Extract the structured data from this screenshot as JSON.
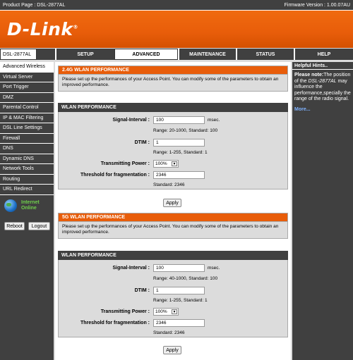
{
  "topbar": {
    "product": "Product Page : DSL-2877AL",
    "firmware": "Firmware Version : 1.00.07AU"
  },
  "brand": {
    "logo": "D-Link",
    "dot": "®"
  },
  "nav": {
    "model": "DSL-2877AL",
    "tabs": [
      "SETUP",
      "ADVANCED",
      "MAINTENANCE",
      "STATUS",
      "HELP"
    ],
    "active_tab": "ADVANCED"
  },
  "sidebar": {
    "items": [
      "Advanced Wireless",
      "Virtual Server",
      "Port Trigger",
      "DMZ",
      "Parental Control",
      "IP & MAC Filtering",
      "DSL Line Settings",
      "Firewall",
      "DNS",
      "Dynamic DNS",
      "Network Tools",
      "Routing",
      "URL Redirect"
    ],
    "status_line1": "Internet",
    "status_line2": "Online",
    "reboot": "Reboot",
    "logout": "Logout"
  },
  "hints": {
    "title": "Helpful Hints..",
    "note_label": "Please note:",
    "note_pre": "The position of the ",
    "note_model": "DSL-2877AL",
    "note_post": " may influence the performance,specially the range of the radio signal.",
    "more": "More..."
  },
  "section1": {
    "title": "2.4G WLAN PERFORMANCE",
    "description": "Please set up the performances of your Access Point. You can modify some of the parameters to obtain an improved performance.",
    "panel_title": "WLAN PERFORMANCE",
    "signal_label": "Signal-Interval :",
    "signal_value": "100",
    "signal_unit": "msec.",
    "signal_range": "Range: 20-1000, Standard: 100",
    "dtim_label": "DTIM :",
    "dtim_value": "1",
    "dtim_range": "Range: 1-255, Standard: 1",
    "power_label": "Transmitting Power :",
    "power_value": "100%",
    "frag_label": "Threshold for fragmentation :",
    "frag_value": "2346",
    "frag_standard": "Standard: 2346",
    "apply": "Apply"
  },
  "section2": {
    "title": "5G WLAN PERFORMANCE",
    "description": "Please set up the performances of your Access Point. You can modify some of the parameters to obtain an improved performance.",
    "panel_title": "WLAN PERFORMANCE",
    "signal_label": "Signal-Interval :",
    "signal_value": "100",
    "signal_unit": "msec.",
    "signal_range": "Range: 40-1000, Standard: 100",
    "dtim_label": "DTIM :",
    "dtim_value": "1",
    "dtim_range": "Range: 1-255, Standard: 1",
    "power_label": "Transmitting Power :",
    "power_value": "100%",
    "frag_label": "Threshold for fragmentation :",
    "frag_value": "2346",
    "frag_standard": "Standard: 2346",
    "apply": "Apply"
  }
}
